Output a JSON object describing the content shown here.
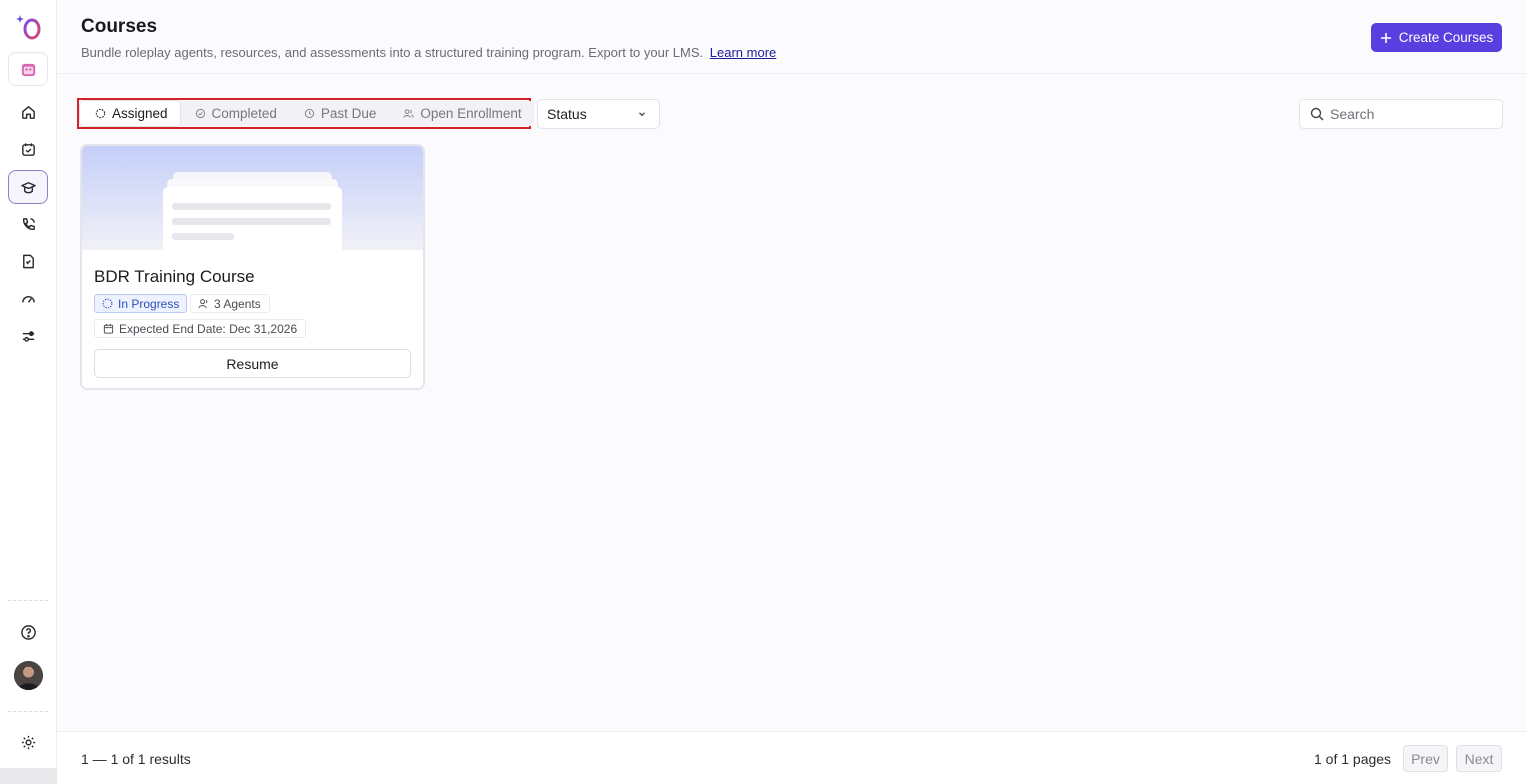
{
  "header": {
    "title": "Courses",
    "subtitle": "Bundle roleplay agents, resources, and assessments into a structured training program. Export to your LMS.",
    "learn_more": "Learn more",
    "create_label": "Create Courses"
  },
  "sidebar": {
    "items": [
      {
        "name": "home",
        "icon": "home-icon"
      },
      {
        "name": "calendar",
        "icon": "calendar-icon"
      },
      {
        "name": "courses",
        "icon": "graduation-cap-icon",
        "active": true
      },
      {
        "name": "calls",
        "icon": "phone-icon"
      },
      {
        "name": "documents",
        "icon": "document-icon"
      },
      {
        "name": "analytics",
        "icon": "gauge-icon"
      },
      {
        "name": "filters",
        "icon": "sliders-icon"
      }
    ],
    "bottom": [
      "help-icon",
      "avatar",
      "settings-icon"
    ]
  },
  "tabs": [
    {
      "label": "Assigned",
      "icon": "loader-icon",
      "active": true
    },
    {
      "label": "Completed",
      "icon": "check-circle-icon",
      "active": false
    },
    {
      "label": "Past Due",
      "icon": "clock-icon",
      "active": false
    },
    {
      "label": "Open Enrollment",
      "icon": "users-icon",
      "active": false
    }
  ],
  "filters": {
    "status_label": "Status",
    "search_placeholder": "Search"
  },
  "courses": [
    {
      "title": "BDR Training Course",
      "status": "In Progress",
      "agents": "3 Agents",
      "end_date": "Expected End Date: Dec 31,2026",
      "action": "Resume"
    }
  ],
  "footer": {
    "results": "1 — 1 of 1 results",
    "pages": "1 of 1 pages",
    "prev": "Prev",
    "next": "Next"
  },
  "colors": {
    "accent": "#5a3fe0",
    "highlight_outline": "#d71f26",
    "status_blue": "#2c4fbf"
  }
}
